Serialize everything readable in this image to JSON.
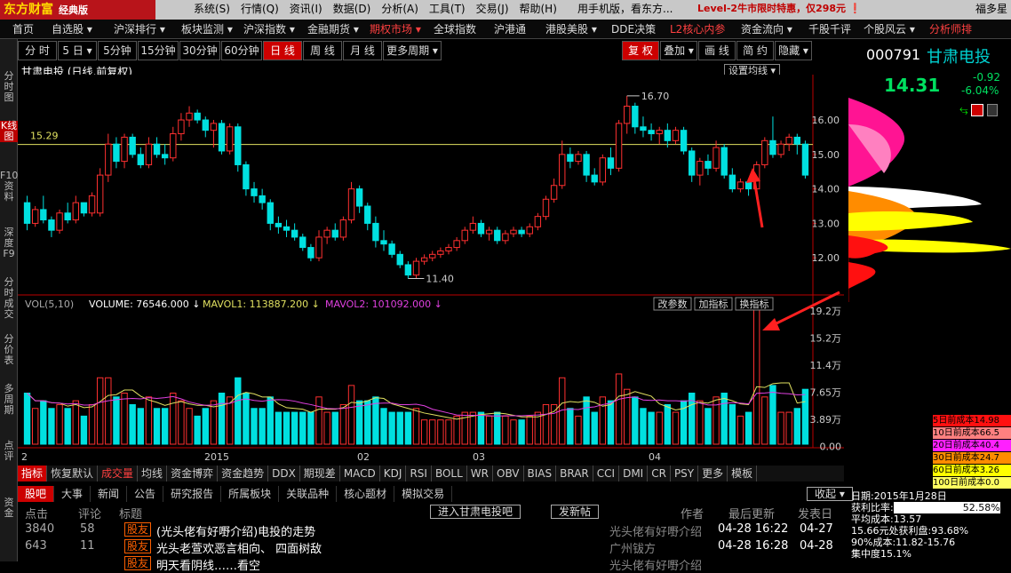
{
  "app": {
    "logo": "东方财富",
    "edition": "经典版",
    "user": "福多星"
  },
  "menus": [
    "系统(S)",
    "行情(Q)",
    "资讯(I)",
    "数据(D)",
    "分析(A)",
    "工具(T)",
    "交易(J)",
    "帮助(H)"
  ],
  "promo1": "用手机版，看东方...",
  "promo2": "Level-2牛市限时特惠，仅298元 ❗",
  "nav": [
    "首页",
    "自选股 ▾",
    "沪深排行 ▾",
    "板块监测 ▾",
    "沪深指数 ▾",
    "金融期货 ▾",
    "期权市场 ▾",
    "全球指数",
    "沪港通",
    "港股美股 ▾",
    "DDE决策",
    "L2核心内参",
    "资金流向 ▾",
    "千股千评",
    "个股风云 ▾",
    "分析师排"
  ],
  "leftbar": [
    {
      "label": "分时图",
      "active": false
    },
    {
      "label": "K线图",
      "active": true
    },
    {
      "label": "F10资料",
      "active": false
    },
    {
      "label": "深度F9",
      "active": false
    },
    {
      "label": "分时成交",
      "active": false
    },
    {
      "label": "分价表",
      "active": false
    },
    {
      "label": "多周期",
      "active": false
    },
    {
      "label": "点评",
      "active": false
    },
    {
      "label": "资金",
      "active": false
    }
  ],
  "periods": [
    "分 时",
    "5 日 ▾",
    "5分钟",
    "15分钟",
    "30分钟",
    "60分钟",
    "日 线",
    "周 线",
    "月 线",
    "更多周期 ▾"
  ],
  "period_active": "日 线",
  "tools": [
    "复 权",
    "叠加 ▾",
    "画 线",
    "简 约",
    "隐藏 ▾"
  ],
  "tool_active": "复 权",
  "chart": {
    "title": "甘肃电投 (日线,前复权)",
    "set_ma": "设置均线 ▾",
    "hline_label": "15.29",
    "price_ticks": [
      "16.00",
      "15.00",
      "14.00",
      "13.00",
      "12.00"
    ],
    "high_label": "16.70",
    "low_label": "11.40",
    "vol_legend": {
      "name": "VOL(5,10)",
      "volume": "VOLUME: 76546.000 ↓",
      "mavol1": "MAVOL1: 113887.200 ↓",
      "mavol2": "MAVOL2: 101092.000 ↓"
    },
    "vol_buttons": [
      "改参数",
      "加指标",
      "换指标"
    ],
    "vol_ticks": [
      "19.2万",
      "15.2万",
      "11.4万",
      "7.65万",
      "3.89万",
      "0.00"
    ],
    "x_labels": [
      "2",
      "2015",
      "02",
      "03",
      "04"
    ]
  },
  "quote": {
    "code": "000791",
    "name": "甘肃电投",
    "price": "14.31",
    "change": "-0.92",
    "change_pct": "-6.04%"
  },
  "indicator_tabs": [
    "指标",
    "恢复默认",
    "成交量",
    "均线",
    "资金博弈",
    "资金趋势",
    "DDX",
    "期现差",
    "MACD",
    "KDJ",
    "RSI",
    "BOLL",
    "WR",
    "OBV",
    "BIAS",
    "BRAR",
    "CCI",
    "DMI",
    "CR",
    "PSY",
    "更多",
    "模板"
  ],
  "indicator_active": "成交量",
  "bottom_tabs": [
    "股吧",
    "大事",
    "新闻",
    "公告",
    "研究报告",
    "所属板块",
    "关联品种",
    "核心题材",
    "模拟交易"
  ],
  "collapse": "收起 ▾",
  "forum": {
    "headers": [
      "点击",
      "评论",
      "标题",
      "作者",
      "最后更新",
      "发表日"
    ],
    "enter_btn": "进入甘肃电投吧",
    "post_btn": "发新帖",
    "rows": [
      {
        "clicks": "3840",
        "comments": "58",
        "tag": "股友",
        "title": "(光头佬有好嘢介绍)电投的走势",
        "author": "光头佬有好嘢介绍",
        "updated": "04-28 16:22",
        "date": "04-27"
      },
      {
        "clicks": "643",
        "comments": "11",
        "tag": "股友",
        "title": "光头老萱欢恶言相向、 四面树敌",
        "author": "广州钹方",
        "updated": "04-28 16:28",
        "date": "04-28"
      },
      {
        "clicks": "",
        "comments": "",
        "tag": "股友",
        "title": "明天看阴线……看空",
        "author": "光头佬有好嘢介绍",
        "updated": "",
        "date": ""
      }
    ]
  },
  "cost_bars": [
    {
      "label": "5日前成本14.98",
      "color": "#ff1010"
    },
    {
      "label": "10日前成本66.5",
      "color": "#ff8080"
    },
    {
      "label": "20日前成本40.4",
      "color": "#ff20ff"
    },
    {
      "label": "30日前成本24.7",
      "color": "#ff8c00"
    },
    {
      "label": "60日前成本3.26",
      "color": "#ffff00"
    },
    {
      "label": "100日前成本0.0",
      "color": "#ffff60"
    }
  ],
  "cost_info": {
    "date": "日期:2015年1月28日",
    "profit_ratio_label": "获利比率:",
    "profit_ratio": "52.58%",
    "avg_cost": "平均成本:13.57",
    "cost_line": "15.66元处获利盘:93.68%",
    "c90": "90%成本:11.82-15.76",
    "concentration": "集中度15.1%"
  },
  "chart_data": {
    "type": "candlestick",
    "price_range": [
      11.4,
      16.7
    ],
    "ohlc_sample": [
      {
        "o": 13.6,
        "h": 13.8,
        "l": 12.8,
        "c": 13.0
      },
      {
        "o": 13.0,
        "h": 13.5,
        "l": 12.9,
        "c": 13.4
      },
      {
        "o": 13.4,
        "h": 13.8,
        "l": 13.0,
        "c": 13.1
      },
      {
        "o": 13.1,
        "h": 13.2,
        "l": 12.6,
        "c": 12.8
      },
      {
        "o": 12.8,
        "h": 13.4,
        "l": 12.7,
        "c": 13.3
      },
      {
        "o": 13.3,
        "h": 13.6,
        "l": 13.0,
        "c": 13.1
      },
      {
        "o": 13.1,
        "h": 13.8,
        "l": 13.0,
        "c": 13.6
      },
      {
        "o": 13.6,
        "h": 13.6,
        "l": 13.2,
        "c": 13.3
      },
      {
        "o": 13.3,
        "h": 13.9,
        "l": 13.2,
        "c": 13.8
      },
      {
        "o": 13.3,
        "h": 14.6,
        "l": 13.2,
        "c": 14.4
      },
      {
        "o": 14.4,
        "h": 15.6,
        "l": 14.2,
        "c": 15.3
      },
      {
        "o": 15.3,
        "h": 15.5,
        "l": 14.6,
        "c": 14.8
      },
      {
        "o": 14.8,
        "h": 15.6,
        "l": 14.6,
        "c": 15.5
      },
      {
        "o": 15.5,
        "h": 15.6,
        "l": 14.9,
        "c": 15.0
      },
      {
        "o": 15.0,
        "h": 15.2,
        "l": 14.6,
        "c": 14.7
      },
      {
        "o": 14.7,
        "h": 15.5,
        "l": 14.6,
        "c": 15.3
      },
      {
        "o": 15.3,
        "h": 15.5,
        "l": 14.9,
        "c": 15.0
      },
      {
        "o": 15.0,
        "h": 15.3,
        "l": 14.7,
        "c": 14.9
      },
      {
        "o": 14.9,
        "h": 15.8,
        "l": 14.8,
        "c": 15.6
      },
      {
        "o": 15.6,
        "h": 16.2,
        "l": 15.4,
        "c": 16.0
      },
      {
        "o": 16.0,
        "h": 16.4,
        "l": 15.8,
        "c": 16.2
      },
      {
        "o": 16.2,
        "h": 16.3,
        "l": 15.9,
        "c": 16.0
      },
      {
        "o": 16.0,
        "h": 16.1,
        "l": 15.5,
        "c": 15.7
      },
      {
        "o": 15.7,
        "h": 16.0,
        "l": 15.2,
        "c": 15.9
      },
      {
        "o": 15.9,
        "h": 16.0,
        "l": 15.0,
        "c": 15.1
      },
      {
        "o": 15.1,
        "h": 15.9,
        "l": 15.0,
        "c": 15.8
      },
      {
        "o": 15.8,
        "h": 15.9,
        "l": 14.5,
        "c": 14.7
      },
      {
        "o": 14.7,
        "h": 14.8,
        "l": 13.8,
        "c": 14.0
      },
      {
        "o": 14.0,
        "h": 14.2,
        "l": 13.6,
        "c": 13.8
      },
      {
        "o": 13.8,
        "h": 14.0,
        "l": 13.4,
        "c": 13.6
      },
      {
        "o": 13.6,
        "h": 13.7,
        "l": 12.8,
        "c": 13.0
      },
      {
        "o": 13.0,
        "h": 13.2,
        "l": 12.7,
        "c": 12.9
      },
      {
        "o": 12.9,
        "h": 13.1,
        "l": 12.6,
        "c": 12.8
      },
      {
        "o": 12.8,
        "h": 13.0,
        "l": 12.5,
        "c": 12.6
      },
      {
        "o": 12.6,
        "h": 12.7,
        "l": 12.2,
        "c": 12.3
      },
      {
        "o": 12.3,
        "h": 12.4,
        "l": 11.9,
        "c": 12.0
      },
      {
        "o": 12.0,
        "h": 12.8,
        "l": 11.9,
        "c": 12.6
      },
      {
        "o": 12.6,
        "h": 12.9,
        "l": 12.4,
        "c": 12.8
      },
      {
        "o": 12.8,
        "h": 13.0,
        "l": 12.5,
        "c": 12.6
      },
      {
        "o": 12.6,
        "h": 13.2,
        "l": 12.5,
        "c": 13.1
      },
      {
        "o": 13.1,
        "h": 14.2,
        "l": 13.0,
        "c": 14.0
      },
      {
        "o": 14.0,
        "h": 14.1,
        "l": 13.3,
        "c": 13.5
      },
      {
        "o": 13.5,
        "h": 13.6,
        "l": 12.8,
        "c": 13.0
      },
      {
        "o": 13.0,
        "h": 13.2,
        "l": 12.3,
        "c": 12.5
      },
      {
        "o": 12.5,
        "h": 12.8,
        "l": 12.2,
        "c": 12.4
      },
      {
        "o": 12.4,
        "h": 12.5,
        "l": 12.0,
        "c": 12.1
      },
      {
        "o": 12.1,
        "h": 12.2,
        "l": 11.7,
        "c": 11.8
      },
      {
        "o": 11.8,
        "h": 11.9,
        "l": 11.4,
        "c": 11.5
      },
      {
        "o": 11.5,
        "h": 12.0,
        "l": 11.4,
        "c": 11.9
      },
      {
        "o": 11.9,
        "h": 12.1,
        "l": 11.8,
        "c": 12.0
      },
      {
        "o": 12.0,
        "h": 12.2,
        "l": 11.9,
        "c": 12.1
      },
      {
        "o": 12.1,
        "h": 12.3,
        "l": 12.0,
        "c": 12.2
      },
      {
        "o": 12.2,
        "h": 12.4,
        "l": 12.1,
        "c": 12.3
      },
      {
        "o": 12.3,
        "h": 12.6,
        "l": 12.2,
        "c": 12.5
      },
      {
        "o": 12.5,
        "h": 12.9,
        "l": 12.4,
        "c": 12.8
      },
      {
        "o": 12.8,
        "h": 13.2,
        "l": 12.7,
        "c": 13.0
      },
      {
        "o": 13.0,
        "h": 13.1,
        "l": 12.6,
        "c": 12.7
      },
      {
        "o": 12.7,
        "h": 12.9,
        "l": 12.5,
        "c": 12.8
      },
      {
        "o": 12.8,
        "h": 12.9,
        "l": 12.4,
        "c": 12.5
      },
      {
        "o": 12.5,
        "h": 12.8,
        "l": 12.4,
        "c": 12.7
      },
      {
        "o": 12.7,
        "h": 12.9,
        "l": 12.6,
        "c": 12.8
      },
      {
        "o": 12.8,
        "h": 12.9,
        "l": 12.6,
        "c": 12.7
      },
      {
        "o": 12.7,
        "h": 13.0,
        "l": 12.6,
        "c": 12.9
      },
      {
        "o": 12.9,
        "h": 13.3,
        "l": 12.8,
        "c": 13.2
      },
      {
        "o": 13.2,
        "h": 13.8,
        "l": 13.1,
        "c": 13.7
      },
      {
        "o": 13.7,
        "h": 14.3,
        "l": 13.6,
        "c": 14.1
      },
      {
        "o": 14.1,
        "h": 15.4,
        "l": 14.0,
        "c": 15.0
      },
      {
        "o": 15.0,
        "h": 15.2,
        "l": 14.6,
        "c": 14.8
      },
      {
        "o": 14.8,
        "h": 15.1,
        "l": 14.7,
        "c": 15.0
      },
      {
        "o": 15.0,
        "h": 15.1,
        "l": 14.2,
        "c": 14.4
      },
      {
        "o": 14.4,
        "h": 14.6,
        "l": 14.1,
        "c": 14.2
      },
      {
        "o": 14.2,
        "h": 15.0,
        "l": 14.1,
        "c": 14.9
      },
      {
        "o": 14.9,
        "h": 15.2,
        "l": 14.4,
        "c": 14.6
      },
      {
        "o": 14.6,
        "h": 16.0,
        "l": 14.5,
        "c": 15.9
      },
      {
        "o": 15.9,
        "h": 16.7,
        "l": 15.6,
        "c": 16.4
      },
      {
        "o": 16.4,
        "h": 16.5,
        "l": 15.6,
        "c": 15.8
      },
      {
        "o": 15.8,
        "h": 16.1,
        "l": 15.5,
        "c": 15.7
      },
      {
        "o": 15.7,
        "h": 15.9,
        "l": 15.4,
        "c": 15.6
      },
      {
        "o": 15.6,
        "h": 15.8,
        "l": 15.3,
        "c": 15.7
      },
      {
        "o": 15.7,
        "h": 15.9,
        "l": 15.2,
        "c": 15.4
      },
      {
        "o": 15.4,
        "h": 15.8,
        "l": 15.3,
        "c": 15.7
      },
      {
        "o": 15.7,
        "h": 15.8,
        "l": 15.0,
        "c": 15.1
      },
      {
        "o": 15.1,
        "h": 15.2,
        "l": 14.2,
        "c": 14.4
      },
      {
        "o": 14.4,
        "h": 14.9,
        "l": 14.1,
        "c": 14.8
      },
      {
        "o": 14.8,
        "h": 15.0,
        "l": 14.4,
        "c": 14.6
      },
      {
        "o": 14.6,
        "h": 15.4,
        "l": 14.5,
        "c": 15.2
      },
      {
        "o": 15.2,
        "h": 15.3,
        "l": 14.3,
        "c": 14.4
      },
      {
        "o": 14.4,
        "h": 14.6,
        "l": 13.9,
        "c": 14.0
      },
      {
        "o": 14.0,
        "h": 14.3,
        "l": 13.9,
        "c": 14.2
      },
      {
        "o": 14.2,
        "h": 14.3,
        "l": 13.8,
        "c": 14.0
      },
      {
        "o": 14.0,
        "h": 14.8,
        "l": 13.7,
        "c": 14.7
      },
      {
        "o": 14.7,
        "h": 15.5,
        "l": 14.6,
        "c": 15.4
      },
      {
        "o": 15.4,
        "h": 16.1,
        "l": 14.9,
        "c": 15.0
      },
      {
        "o": 15.0,
        "h": 15.4,
        "l": 14.9,
        "c": 15.3
      },
      {
        "o": 15.3,
        "h": 15.6,
        "l": 15.1,
        "c": 15.5
      },
      {
        "o": 15.5,
        "h": 15.6,
        "l": 15.0,
        "c": 15.3
      },
      {
        "o": 15.3,
        "h": 15.4,
        "l": 14.3,
        "c": 14.4
      }
    ]
  }
}
